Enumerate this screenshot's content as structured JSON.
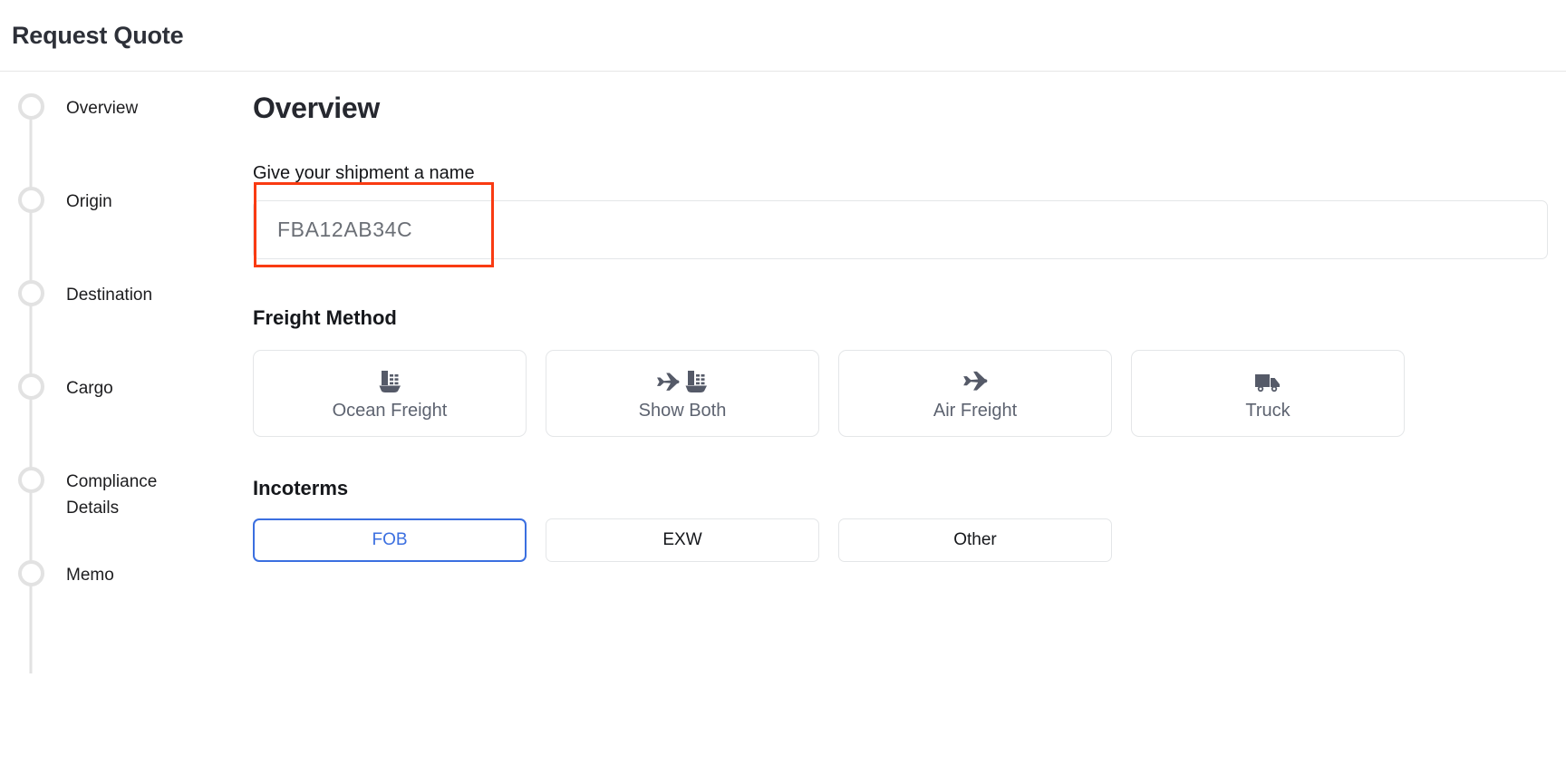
{
  "header": {
    "title": "Request Quote"
  },
  "stepper": {
    "items": [
      {
        "label": "Overview"
      },
      {
        "label": "Origin"
      },
      {
        "label": "Destination"
      },
      {
        "label": "Cargo"
      },
      {
        "label": "Compliance Details"
      },
      {
        "label": "Memo"
      }
    ]
  },
  "overview": {
    "section_title": "Overview",
    "shipment_name": {
      "label": "Give your shipment a name",
      "value": "FBA12AB34C",
      "placeholder": "FBA12AB34C"
    },
    "freight_method": {
      "label": "Freight Method",
      "options": [
        {
          "label": "Ocean Freight",
          "icons": [
            "ship-icon"
          ]
        },
        {
          "label": "Show Both",
          "icons": [
            "plane-icon",
            "ship-icon"
          ]
        },
        {
          "label": "Air Freight",
          "icons": [
            "plane-icon"
          ]
        },
        {
          "label": "Truck",
          "icons": [
            "truck-icon"
          ]
        }
      ]
    },
    "incoterms": {
      "label": "Incoterms",
      "options": [
        {
          "label": "FOB",
          "selected": true
        },
        {
          "label": "EXW",
          "selected": false
        },
        {
          "label": "Other",
          "selected": false
        }
      ]
    }
  },
  "annotation": {
    "color": "#f93b12"
  },
  "colors": {
    "accent_blue": "#3b6fe0",
    "icon_slate": "#555a68",
    "border_gray": "#e4e6e8",
    "rail_gray": "#e2e2e2"
  }
}
